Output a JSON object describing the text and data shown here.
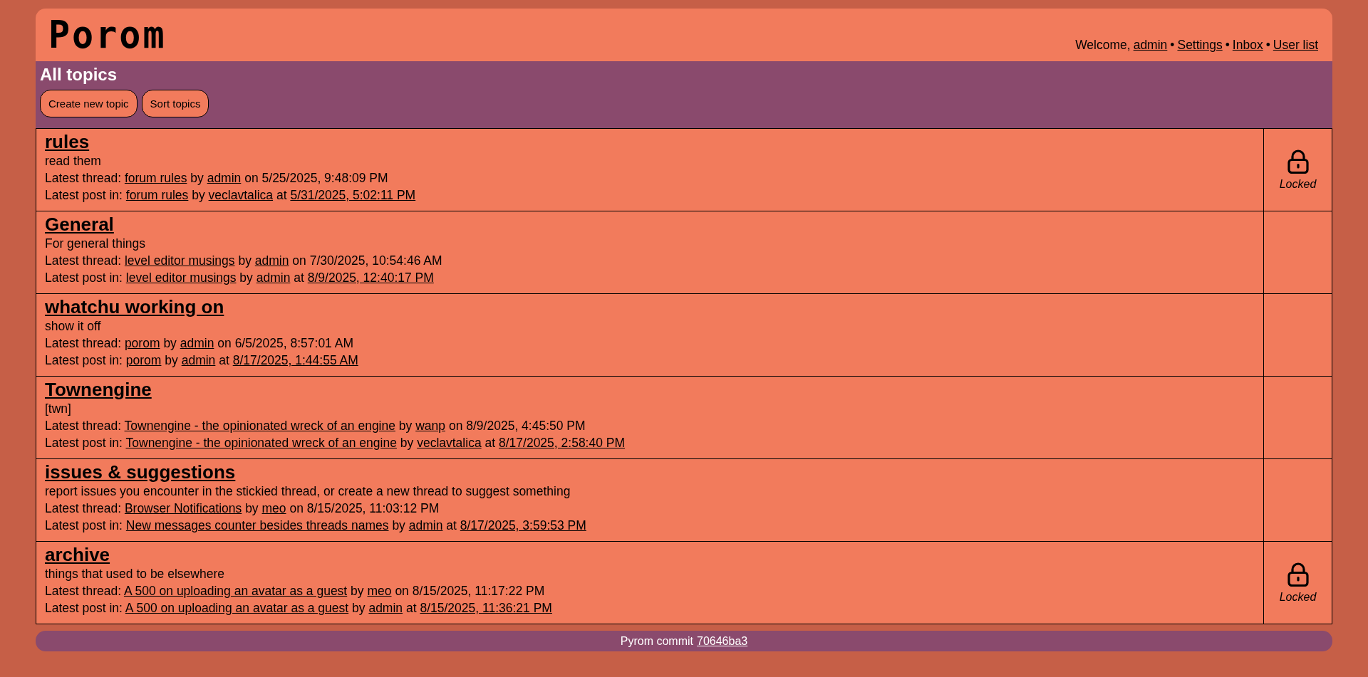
{
  "site": {
    "logo": "Porom"
  },
  "user_nav": {
    "welcome": "Welcome,",
    "user": "admin",
    "links": [
      {
        "separator": "•",
        "label": "Settings"
      },
      {
        "separator": "•",
        "label": "Inbox"
      },
      {
        "separator": "•",
        "label": "User list"
      }
    ]
  },
  "page": {
    "title": "All topics",
    "buttons": [
      "Create new topic",
      "Sort topics"
    ]
  },
  "topics": [
    {
      "title": "rules",
      "description": "read them",
      "latest_thread": {
        "label": "Latest thread:",
        "title": "forum rules",
        "by_word": "by",
        "by": "admin",
        "date_word": "on",
        "date": "5/25/2025, 9:48:09 PM"
      },
      "latest_post": {
        "label": "Latest post in:",
        "title": "forum rules",
        "by_word": "by",
        "by": "veclavtalica",
        "date_word": "at",
        "date": "5/31/2025, 5:02:11 PM"
      },
      "locked": true,
      "lock_label": "Locked"
    },
    {
      "title": "General",
      "description": "For general things",
      "latest_thread": {
        "label": "Latest thread:",
        "title": "level editor musings",
        "by_word": "by",
        "by": "admin",
        "date_word": "on",
        "date": "7/30/2025, 10:54:46 AM"
      },
      "latest_post": {
        "label": "Latest post in:",
        "title": "level editor musings",
        "by_word": "by",
        "by": "admin",
        "date_word": "at",
        "date": "8/9/2025, 12:40:17 PM"
      },
      "locked": false
    },
    {
      "title": "whatchu working on",
      "description": "show it off",
      "latest_thread": {
        "label": "Latest thread:",
        "title": "porom",
        "by_word": "by",
        "by": "admin",
        "date_word": "on",
        "date": "6/5/2025, 8:57:01 AM"
      },
      "latest_post": {
        "label": "Latest post in:",
        "title": "porom",
        "by_word": "by",
        "by": "admin",
        "date_word": "at",
        "date": "8/17/2025, 1:44:55 AM"
      },
      "locked": false
    },
    {
      "title": "Townengine",
      "description": "[twn]",
      "latest_thread": {
        "label": "Latest thread:",
        "title": "Townengine - the opinionated wreck of an engine",
        "by_word": "by",
        "by": "wanp",
        "date_word": "on",
        "date": "8/9/2025, 4:45:50 PM"
      },
      "latest_post": {
        "label": "Latest post in:",
        "title": "Townengine - the opinionated wreck of an engine",
        "by_word": "by",
        "by": "veclavtalica",
        "date_word": "at",
        "date": "8/17/2025, 2:58:40 PM"
      },
      "locked": false
    },
    {
      "title": "issues & suggestions",
      "description": "report issues you encounter in the stickied thread, or create a new thread to suggest something",
      "latest_thread": {
        "label": "Latest thread:",
        "title": "Browser Notifications",
        "by_word": "by",
        "by": "meo",
        "date_word": "on",
        "date": "8/15/2025, 11:03:12 PM"
      },
      "latest_post": {
        "label": "Latest post in:",
        "title": "New messages counter besides threads names",
        "by_word": "by",
        "by": "admin",
        "date_word": "at",
        "date": "8/17/2025, 3:59:53 PM"
      },
      "locked": false
    },
    {
      "title": "archive",
      "description": "things that used to be elsewhere",
      "latest_thread": {
        "label": "Latest thread:",
        "title": "A 500 on uploading an avatar as a guest",
        "by_word": "by",
        "by": "meo",
        "date_word": "on",
        "date": "8/15/2025, 11:17:22 PM"
      },
      "latest_post": {
        "label": "Latest post in:",
        "title": "A 500 on uploading an avatar as a guest",
        "by_word": "by",
        "by": "admin",
        "date_word": "at",
        "date": "8/15/2025, 11:36:21 PM"
      },
      "locked": true,
      "lock_label": "Locked"
    }
  ],
  "footer": {
    "text": "Pyrom commit",
    "commit": "70646ba3"
  }
}
